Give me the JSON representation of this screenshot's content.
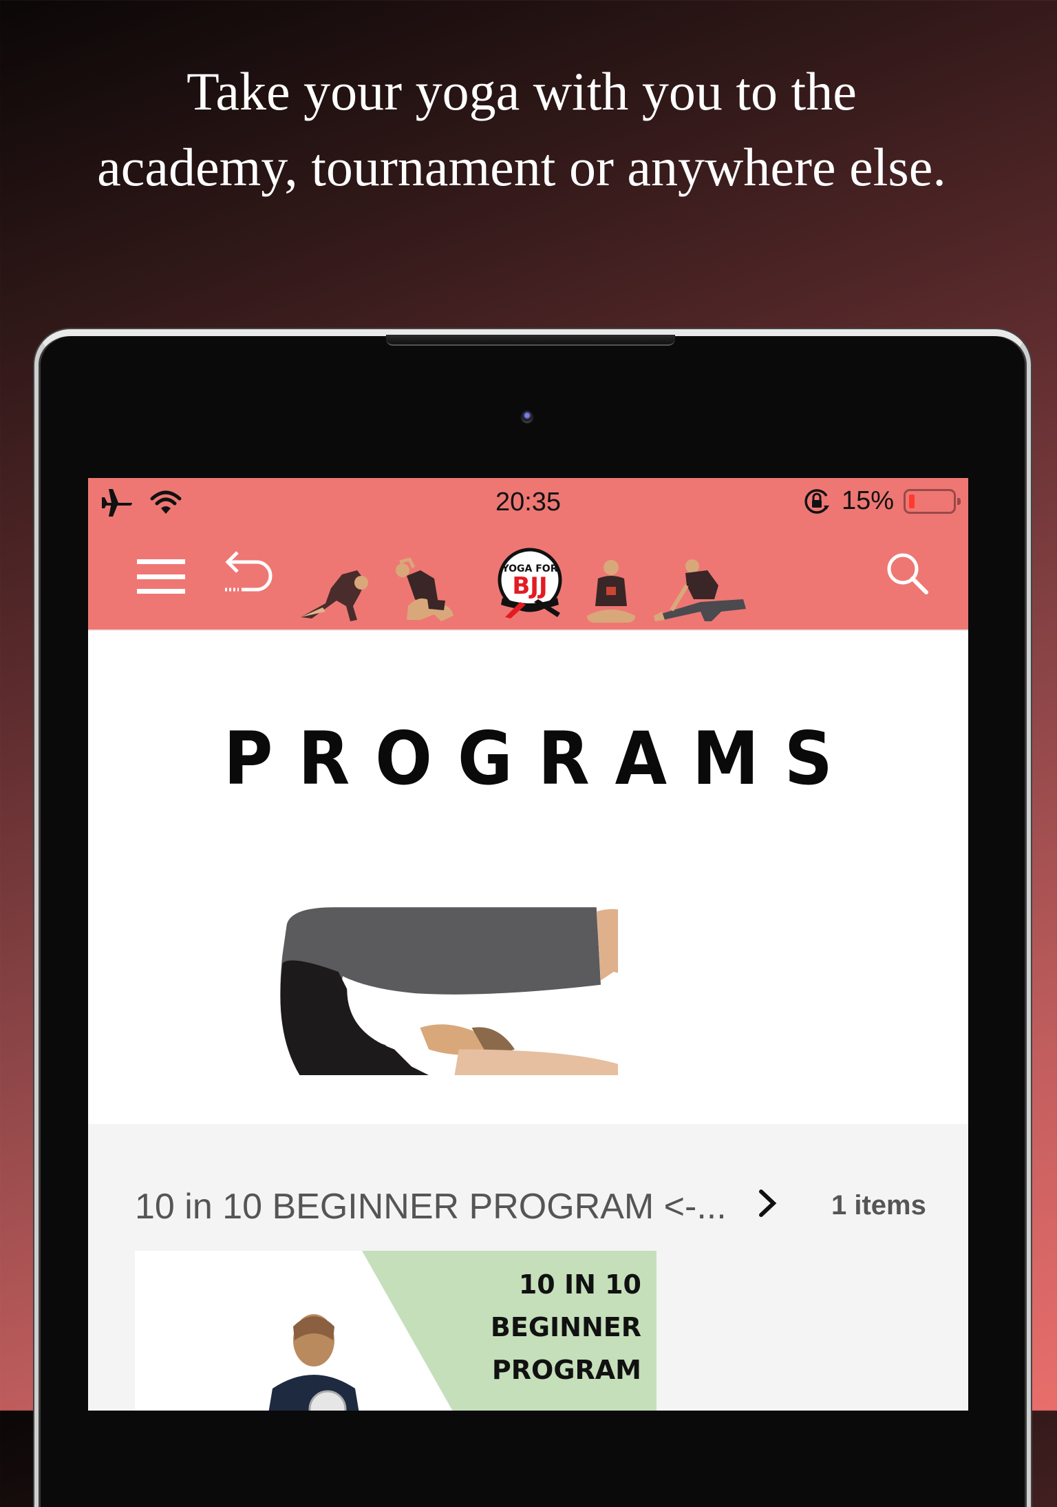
{
  "headline": {
    "line1": "Take your yoga with you to the",
    "line2": "academy, tournament or anywhere else."
  },
  "status_bar": {
    "icons_left": [
      "airplane-icon",
      "wifi-icon"
    ],
    "time": "20:35",
    "rotation_lock_icon": "rotation-lock-icon",
    "battery_percent_label": "15%",
    "battery_level": 0.15,
    "battery_fill_color": "#ff3a30"
  },
  "navbar": {
    "background_color": "#ee7773",
    "menu_icon": "hamburger-icon",
    "back_icon": "undo-back-icon",
    "logo": {
      "top_text": "YOGA FOR",
      "main_text": "BJJ"
    },
    "pose_images": [
      "pose-stretch-1",
      "pose-squat-side-bend",
      "pose-seated-cross-legged",
      "pose-side-lunge"
    ],
    "search_icon": "search-icon"
  },
  "banner": {
    "title": "PROGRAMS",
    "image": "plow-pose-photo"
  },
  "programs": [
    {
      "title": "10 in 10 BEGINNER PROGRAM <-...",
      "chevron_icon": "chevron-right-icon",
      "count_label": "1 items",
      "thumbnail": {
        "line1": "10 IN 10",
        "line2": "BEGINNER",
        "line3": "PROGRAM",
        "accent_color": "#c5dfbb"
      }
    }
  ]
}
